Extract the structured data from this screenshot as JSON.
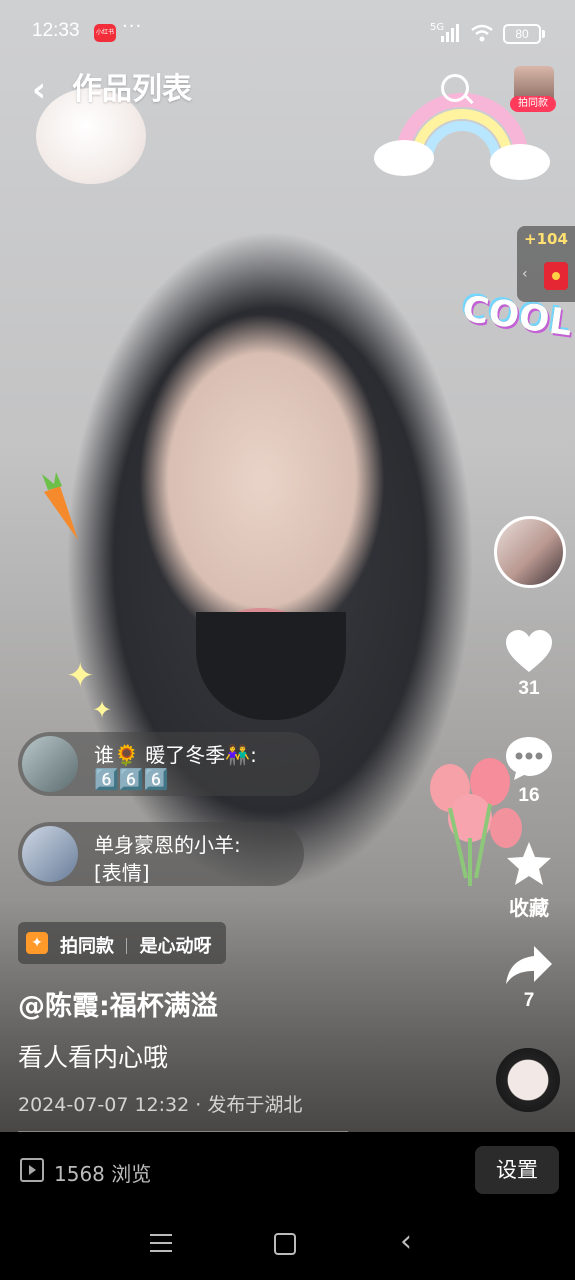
{
  "status_bar": {
    "time": "12:33",
    "app_badge": "小红书",
    "more": "···",
    "network": "5G",
    "battery": "80"
  },
  "header": {
    "back_label": "‹",
    "title": "作品列表",
    "shoot_same_label": "拍同款"
  },
  "side": {
    "redpack_count": "+104",
    "like_count": "31",
    "comment_count": "16",
    "collect_label": "收藏",
    "share_count": "7"
  },
  "comments": [
    {
      "user": "谁🌻 暖了冬季👫:",
      "text": "6️⃣6️⃣6️⃣"
    },
    {
      "user": "单身蒙恩的小羊:",
      "text": "[表情]"
    }
  ],
  "same_style": {
    "label": "拍同款",
    "name": "是心动呀"
  },
  "caption": {
    "author": "@陈霞:福杯满溢",
    "text": "看人看内心哦",
    "meta": "2024-07-07 12:32 · 发布于湖北"
  },
  "bottom": {
    "views": "1568 浏览",
    "settings_label": "设置"
  },
  "stickers": {
    "cool": "COOL"
  }
}
